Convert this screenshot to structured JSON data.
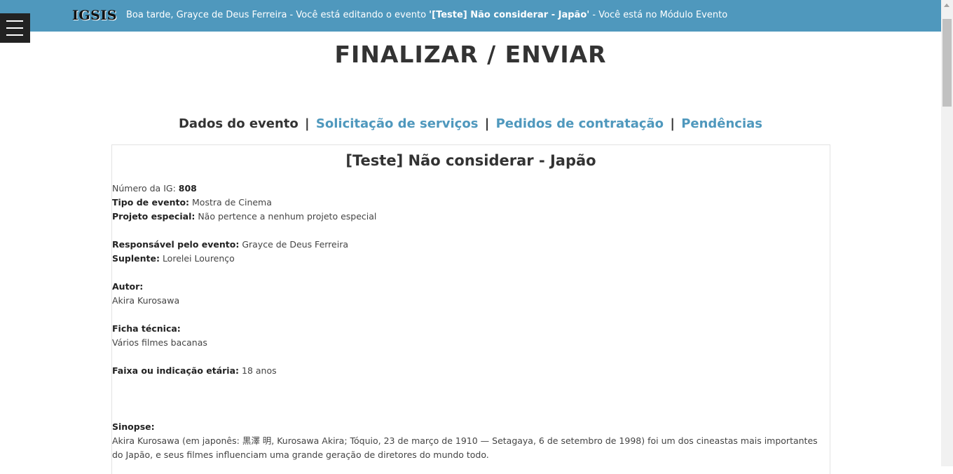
{
  "header": {
    "logo": "IGSIS",
    "greeting_prefix": "Boa tarde, Grayce de Deus Ferreira - Você está editando o evento ",
    "greeting_event": "'[Teste] Não considerar - Japão'",
    "greeting_suffix": " - Você está no Módulo Evento"
  },
  "page": {
    "title": "FINALIZAR / ENVIAR"
  },
  "nav": {
    "current": "Dados do evento",
    "separator": "|",
    "links": [
      "Solicitação de serviços",
      "Pedidos de contratação",
      "Pendências"
    ]
  },
  "event": {
    "title": "[Teste] Não considerar - Japão",
    "numero_label": "Número da IG: ",
    "numero_value": "808",
    "tipo_label": "Tipo de evento:",
    "tipo_value": " Mostra de Cinema",
    "projeto_label": "Projeto especial:",
    "projeto_value": " Não pertence a nenhum projeto especial",
    "responsavel_label": "Responsável pelo evento:",
    "responsavel_value": " Grayce de Deus Ferreira",
    "suplente_label": "Suplente:",
    "suplente_value": " Lorelei Lourenço",
    "autor_label": "Autor:",
    "autor_value": "Akira Kurosawa",
    "ficha_label": "Ficha técnica:",
    "ficha_value": "Vários filmes bacanas",
    "faixa_label": "Faixa ou indicação etária:",
    "faixa_value": " 18 anos",
    "sinopse_label": "Sinopse:",
    "sinopse_value": "Akira Kurosawa (em japonês: 黒澤 明, Kurosawa Akira; Tóquio, 23 de março de 1910 — Setagaya, 6 de setembro de 1998) foi um dos cineastas mais importantes do Japão, e seus filmes influenciam uma grande geração de diretores do mundo todo."
  }
}
